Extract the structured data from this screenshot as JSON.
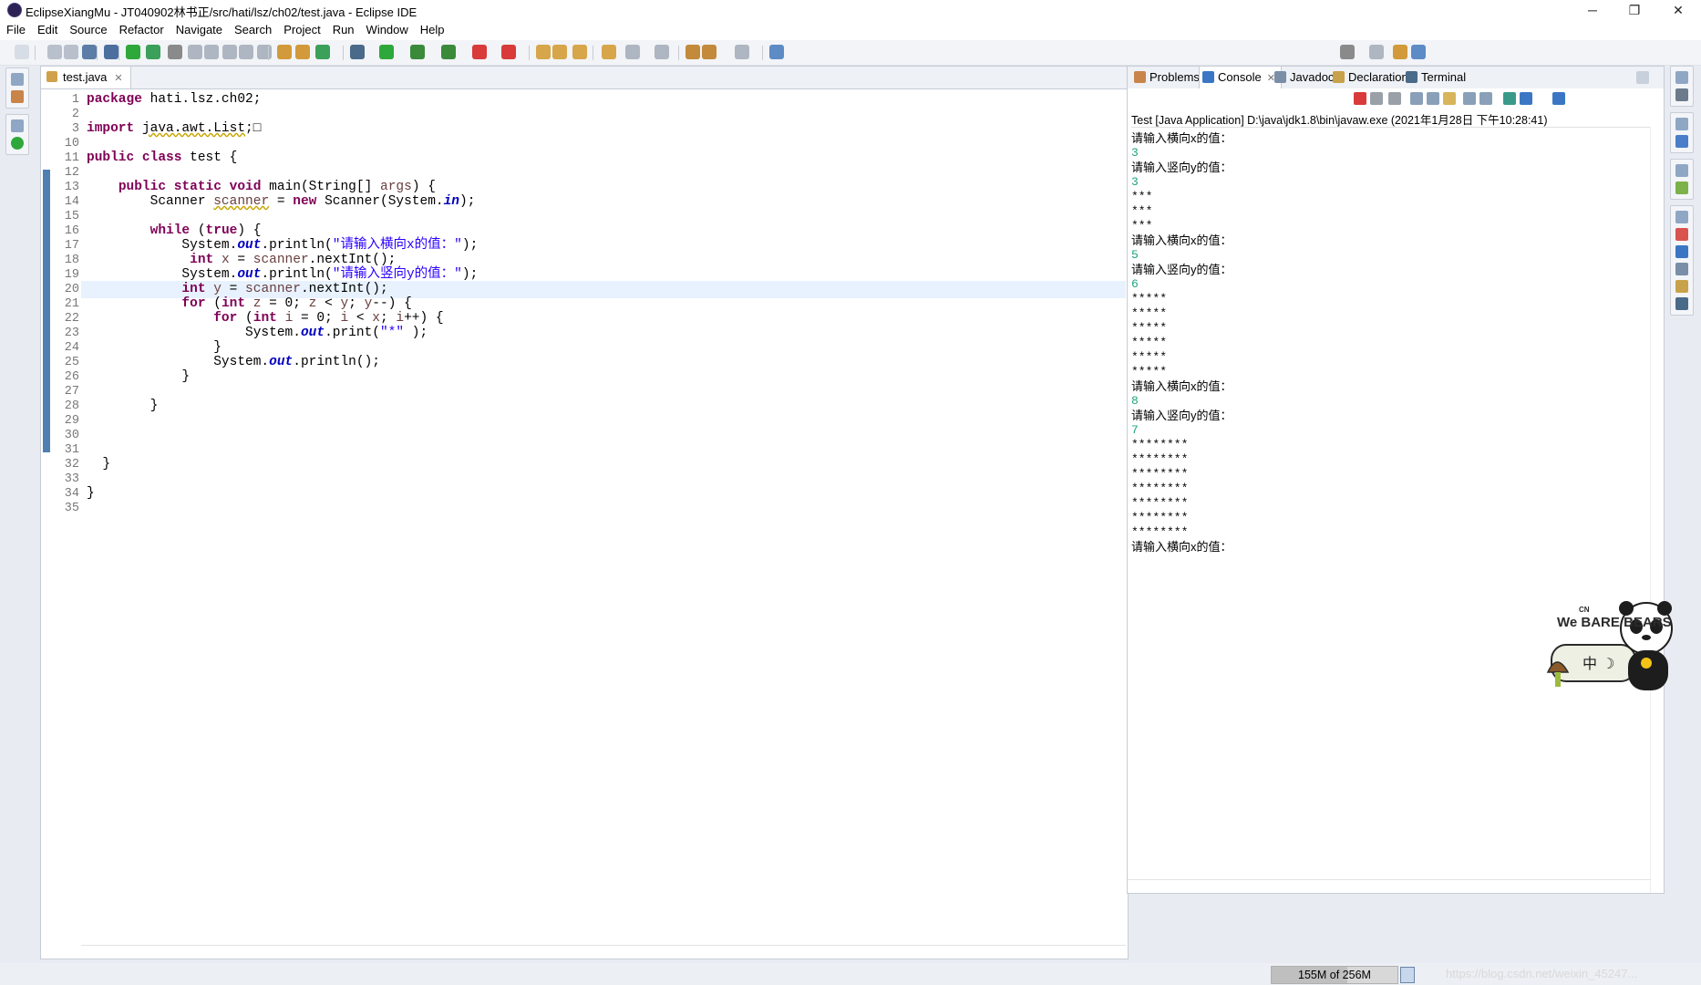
{
  "window": {
    "title": "EclipseXiangMu - JT040902林书正/src/hati/lsz/ch02/test.java - Eclipse IDE",
    "min_glyph": "─",
    "restore_glyph": "❐",
    "close_glyph": "✕"
  },
  "menu": [
    "File",
    "Edit",
    "Source",
    "Refactor",
    "Navigate",
    "Search",
    "Project",
    "Run",
    "Window",
    "Help"
  ],
  "editor": {
    "tab_label": "test.java",
    "tab_close": "✕",
    "line_numbers": [
      "1",
      "2",
      "3",
      "10",
      "11",
      "12",
      "13",
      "14",
      "15",
      "16",
      "17",
      "18",
      "19",
      "20",
      "21",
      "22",
      "23",
      "24",
      "25",
      "26",
      "27",
      "28",
      "29",
      "30",
      "31",
      "32",
      "33",
      "34",
      "35"
    ],
    "highlight_line": "20"
  },
  "console": {
    "tabs": [
      "Problems",
      "Console",
      "Javadoc",
      "Declaration",
      "Terminal"
    ],
    "active_tab": "Console",
    "tab_close": "✕",
    "description": "Test [Java Application] D:\\java\\jdk1.8\\bin\\javaw.exe (2021年1月28日 下午10:28:41)",
    "output": [
      {
        "t": "请输入横向x的值：",
        "k": "prompt"
      },
      {
        "t": "3",
        "k": "in"
      },
      {
        "t": "请输入竖向y的值：",
        "k": "prompt"
      },
      {
        "t": "3",
        "k": "in"
      },
      {
        "t": "***",
        "k": "out"
      },
      {
        "t": "***",
        "k": "out"
      },
      {
        "t": "***",
        "k": "out"
      },
      {
        "t": "请输入横向x的值：",
        "k": "prompt"
      },
      {
        "t": "5",
        "k": "in"
      },
      {
        "t": "请输入竖向y的值：",
        "k": "prompt"
      },
      {
        "t": "6",
        "k": "in"
      },
      {
        "t": "*****",
        "k": "out"
      },
      {
        "t": "*****",
        "k": "out"
      },
      {
        "t": "*****",
        "k": "out"
      },
      {
        "t": "*****",
        "k": "out"
      },
      {
        "t": "*****",
        "k": "out"
      },
      {
        "t": "*****",
        "k": "out"
      },
      {
        "t": "请输入横向x的值：",
        "k": "prompt"
      },
      {
        "t": "8",
        "k": "in"
      },
      {
        "t": "请输入竖向y的值：",
        "k": "prompt"
      },
      {
        "t": "7",
        "k": "in"
      },
      {
        "t": "********",
        "k": "out"
      },
      {
        "t": "********",
        "k": "out"
      },
      {
        "t": "********",
        "k": "out"
      },
      {
        "t": "********",
        "k": "out"
      },
      {
        "t": "********",
        "k": "out"
      },
      {
        "t": "********",
        "k": "out"
      },
      {
        "t": "********",
        "k": "out"
      },
      {
        "t": "请输入横向x的值：",
        "k": "prompt"
      }
    ]
  },
  "code_lines": [
    [
      {
        "t": "package",
        "c": "kw"
      },
      {
        "t": " hati.lsz.ch02;"
      }
    ],
    [],
    [
      {
        "t": "import",
        "c": "kw"
      },
      {
        "t": " "
      },
      {
        "t": "java.awt.List",
        "c": "warnul"
      },
      {
        "t": ";"
      },
      {
        "t": "□"
      }
    ],
    [],
    [
      {
        "t": "public",
        "c": "kw"
      },
      {
        "t": " "
      },
      {
        "t": "class",
        "c": "kw"
      },
      {
        "t": " test {"
      }
    ],
    [],
    [
      {
        "t": "    "
      },
      {
        "t": "public",
        "c": "kw"
      },
      {
        "t": " "
      },
      {
        "t": "static",
        "c": "kw"
      },
      {
        "t": " "
      },
      {
        "t": "void",
        "c": "kw"
      },
      {
        "t": " main(String[] "
      },
      {
        "t": "args",
        "c": "loc"
      },
      {
        "t": ") {"
      }
    ],
    [
      {
        "t": "        Scanner "
      },
      {
        "t": "scanner",
        "c": "loc warnul"
      },
      {
        "t": " = "
      },
      {
        "t": "new",
        "c": "kw"
      },
      {
        "t": " Scanner(System."
      },
      {
        "t": "in",
        "c": "fld"
      },
      {
        "t": ");"
      }
    ],
    [],
    [
      {
        "t": "        "
      },
      {
        "t": "while",
        "c": "kw"
      },
      {
        "t": " ("
      },
      {
        "t": "true",
        "c": "kw"
      },
      {
        "t": ") {"
      }
    ],
    [
      {
        "t": "            System."
      },
      {
        "t": "out",
        "c": "fld"
      },
      {
        "t": ".println("
      },
      {
        "t": "\"请输入横向x的值：\"",
        "c": "str"
      },
      {
        "t": ");"
      }
    ],
    [
      {
        "t": "             "
      },
      {
        "t": "int",
        "c": "kw"
      },
      {
        "t": " "
      },
      {
        "t": "x",
        "c": "loc"
      },
      {
        "t": " = "
      },
      {
        "t": "scanner",
        "c": "loc"
      },
      {
        "t": ".nextInt();"
      }
    ],
    [
      {
        "t": "            System."
      },
      {
        "t": "out",
        "c": "fld"
      },
      {
        "t": ".println("
      },
      {
        "t": "\"请输入竖向y的值：\"",
        "c": "str"
      },
      {
        "t": ");"
      }
    ],
    [
      {
        "t": "            "
      },
      {
        "t": "int",
        "c": "kw"
      },
      {
        "t": " "
      },
      {
        "t": "y",
        "c": "loc"
      },
      {
        "t": " = "
      },
      {
        "t": "scanner",
        "c": "loc"
      },
      {
        "t": ".nextInt();"
      }
    ],
    [
      {
        "t": "            "
      },
      {
        "t": "for",
        "c": "kw"
      },
      {
        "t": " ("
      },
      {
        "t": "int",
        "c": "kw"
      },
      {
        "t": " "
      },
      {
        "t": "z",
        "c": "loc"
      },
      {
        "t": " = 0; "
      },
      {
        "t": "z",
        "c": "loc"
      },
      {
        "t": " < "
      },
      {
        "t": "y",
        "c": "loc"
      },
      {
        "t": "; "
      },
      {
        "t": "y",
        "c": "loc"
      },
      {
        "t": "--) {"
      }
    ],
    [
      {
        "t": "                "
      },
      {
        "t": "for",
        "c": "kw"
      },
      {
        "t": " ("
      },
      {
        "t": "int",
        "c": "kw"
      },
      {
        "t": " "
      },
      {
        "t": "i",
        "c": "loc"
      },
      {
        "t": " = 0; "
      },
      {
        "t": "i",
        "c": "loc"
      },
      {
        "t": " < "
      },
      {
        "t": "x",
        "c": "loc"
      },
      {
        "t": "; "
      },
      {
        "t": "i",
        "c": "loc"
      },
      {
        "t": "++) {"
      }
    ],
    [
      {
        "t": "                    System."
      },
      {
        "t": "out",
        "c": "fld"
      },
      {
        "t": ".print("
      },
      {
        "t": "\"*\"",
        "c": "str"
      },
      {
        "t": " );"
      }
    ],
    [
      {
        "t": "                }"
      }
    ],
    [
      {
        "t": "                System."
      },
      {
        "t": "out",
        "c": "fld"
      },
      {
        "t": ".println();"
      }
    ],
    [
      {
        "t": "            }"
      }
    ],
    [],
    [
      {
        "t": "        }"
      }
    ],
    [],
    [],
    [],
    [
      {
        "t": "  }"
      }
    ],
    [],
    [
      {
        "t": "}"
      }
    ],
    []
  ],
  "status": {
    "heap": "155M of 256M",
    "heap_used_fraction": 0.605,
    "watermark": "https://blog.csdn.net/weixin_45247..."
  },
  "sticker": {
    "brand": "We BARE BEARS",
    "cn": "CN",
    "ime": "中 ☽"
  },
  "colors": {
    "keyword": "#7f0055",
    "string": "#2a00ff",
    "field": "#0000c0",
    "console_input": "#1fa37f",
    "change_bar": "#4f7fb0"
  }
}
